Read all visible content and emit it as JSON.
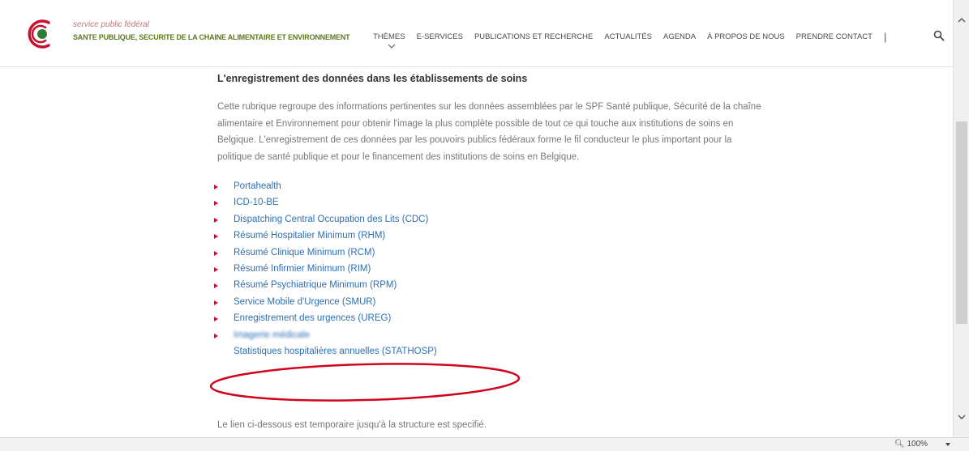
{
  "header": {
    "org_top": "service public fédéral",
    "org_main": "SANTE PUBLIQUE, SECURITE DE LA CHAINE ALIMENTAIRE ET ENVIRONNEMENT",
    "nav": [
      "THÈMES",
      "E-SERVICES",
      "PUBLICATIONS ET RECHERCHE",
      "ACTUALITÉS",
      "AGENDA",
      "À PROPOS DE NOUS",
      "PRENDRE CONTACT"
    ],
    "separator": "|",
    "brand_colors": {
      "logo_red": "#c8102e",
      "logo_green": "#2e7d32",
      "org_green": "#5a7a1e"
    }
  },
  "main": {
    "title": "L'enregistrement des données dans les établissements de soins",
    "intro": "Cette rubrique regroupe des informations pertinentes sur les données assemblées par le SPF Santé publique, Sécurité de la chaîne alimentaire et Environnement pour obtenir l'image la plus complète possible de tout ce qui touche aux institutions de soins en Belgique. L'enregistrement de ces données par les pouvoirs publics fédéraux forme le fil conducteur le plus important pour la politique de santé publique et pour le financement des institutions de soins en Belgique.",
    "links": [
      "Portahealth",
      "ICD-10-BE",
      "Dispatching Central Occupation des Lits (CDC)",
      "Résumé Hospitalier Minimum (RHM)",
      "Résumé Clinique Minimum (RCM)",
      "Résumé Infirmier Minimum (RIM)",
      "Résumé Psychiatrique Minimum (RPM)",
      "Service Mobile d'Urgence (SMUR)",
      "Enregistrement des urgences (UREG)",
      "Imagerie médicale",
      "Statistiques hospitalières annuelles (STATHOSP)"
    ],
    "footer_note": "Le lien ci-dessous est temporaire jusqu'à la structure est specifié.",
    "highlight_color": "#d0021b"
  },
  "statusbar": {
    "zoom": "100%"
  }
}
